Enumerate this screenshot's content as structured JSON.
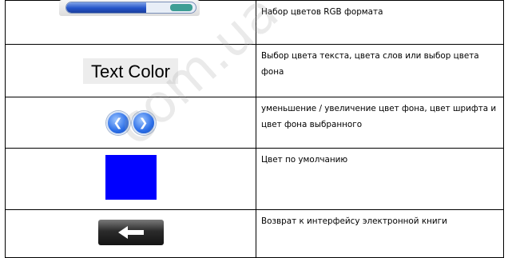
{
  "rows": [
    {
      "icon": "rgb-color-bar",
      "progress_fraction": 0.62,
      "description": "Набор цветов RGB формата"
    },
    {
      "button_label": "Text Color",
      "description": "Выбор цвета текста, цвета слов  или выбор цвета фона"
    },
    {
      "icons": [
        "left-arrow-icon",
        "right-arrow-icon"
      ],
      "description": "уменьшение / увеличение цвет фона, цвет шрифта и цвет фона выбранного"
    },
    {
      "swatch_color": "#0000ff",
      "description": "Цвет по умолчанию"
    },
    {
      "icon": "back-arrow-icon",
      "description": "Возврат к интерфейсу электронной книги"
    }
  ],
  "watermark": "com.ua"
}
